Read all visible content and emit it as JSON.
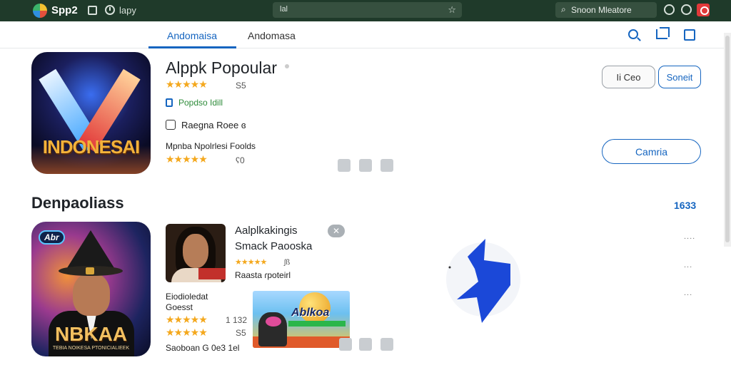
{
  "topbar": {
    "app_name": "Spp2",
    "tab_label": "lapy",
    "url_text": "lal",
    "search_text": "Snoon Mleatore"
  },
  "subnav": {
    "tabs": [
      {
        "label": "Andomaisa",
        "active": true
      },
      {
        "label": "Andomasa",
        "active": false
      }
    ]
  },
  "featured": {
    "icon_text": "INDONESAI",
    "title": "Alppk Popoular",
    "stars": "★★★★★",
    "rating": "S5",
    "popular_label": "Popdso Idill",
    "range_label": "Raegna Roee ɞ",
    "sub_label": "Mpnba Npolrlesi Foolds",
    "sub_stars": "★★★★★",
    "sub_rating": "ʕ0",
    "buttons": {
      "close": "Ii Ceo",
      "search": "Soneit",
      "camera": "Camria"
    }
  },
  "section": {
    "title": "Denpaoliass",
    "count": "1633"
  },
  "list_app": {
    "icon_pill": "Abr",
    "icon_text": "NBKAA",
    "icon_caption": "TEBIA NOIKESA PTONICIALIEEK",
    "title_line1": "Aalplkakingis",
    "title_line2": "Smack Paooska",
    "close_label": "✕",
    "stars": "★★★★★",
    "rating": "ʃß",
    "rating_label": "Raasta ɾpoteirl",
    "sub_title": "Eiodioledat",
    "sub_label": "Goesst",
    "sub_stars_1": "★★★★★",
    "sub_rating_1": "1 132",
    "sub_stars_2": "★★★★★",
    "sub_rating_2": "S5",
    "footer_label": "Saoboan G 0e3 1el",
    "banner_title": "Ablkoa",
    "dots": [
      "....",
      "...",
      "..."
    ]
  },
  "colors": {
    "accent": "#1565c0",
    "star": "#f4a81d",
    "popular_green": "#2e8b3a",
    "topbar_bg": "#1f3a2a"
  },
  "icons": [
    "search-icon",
    "crop-icon",
    "square-icon",
    "tag-icon",
    "close-icon"
  ]
}
